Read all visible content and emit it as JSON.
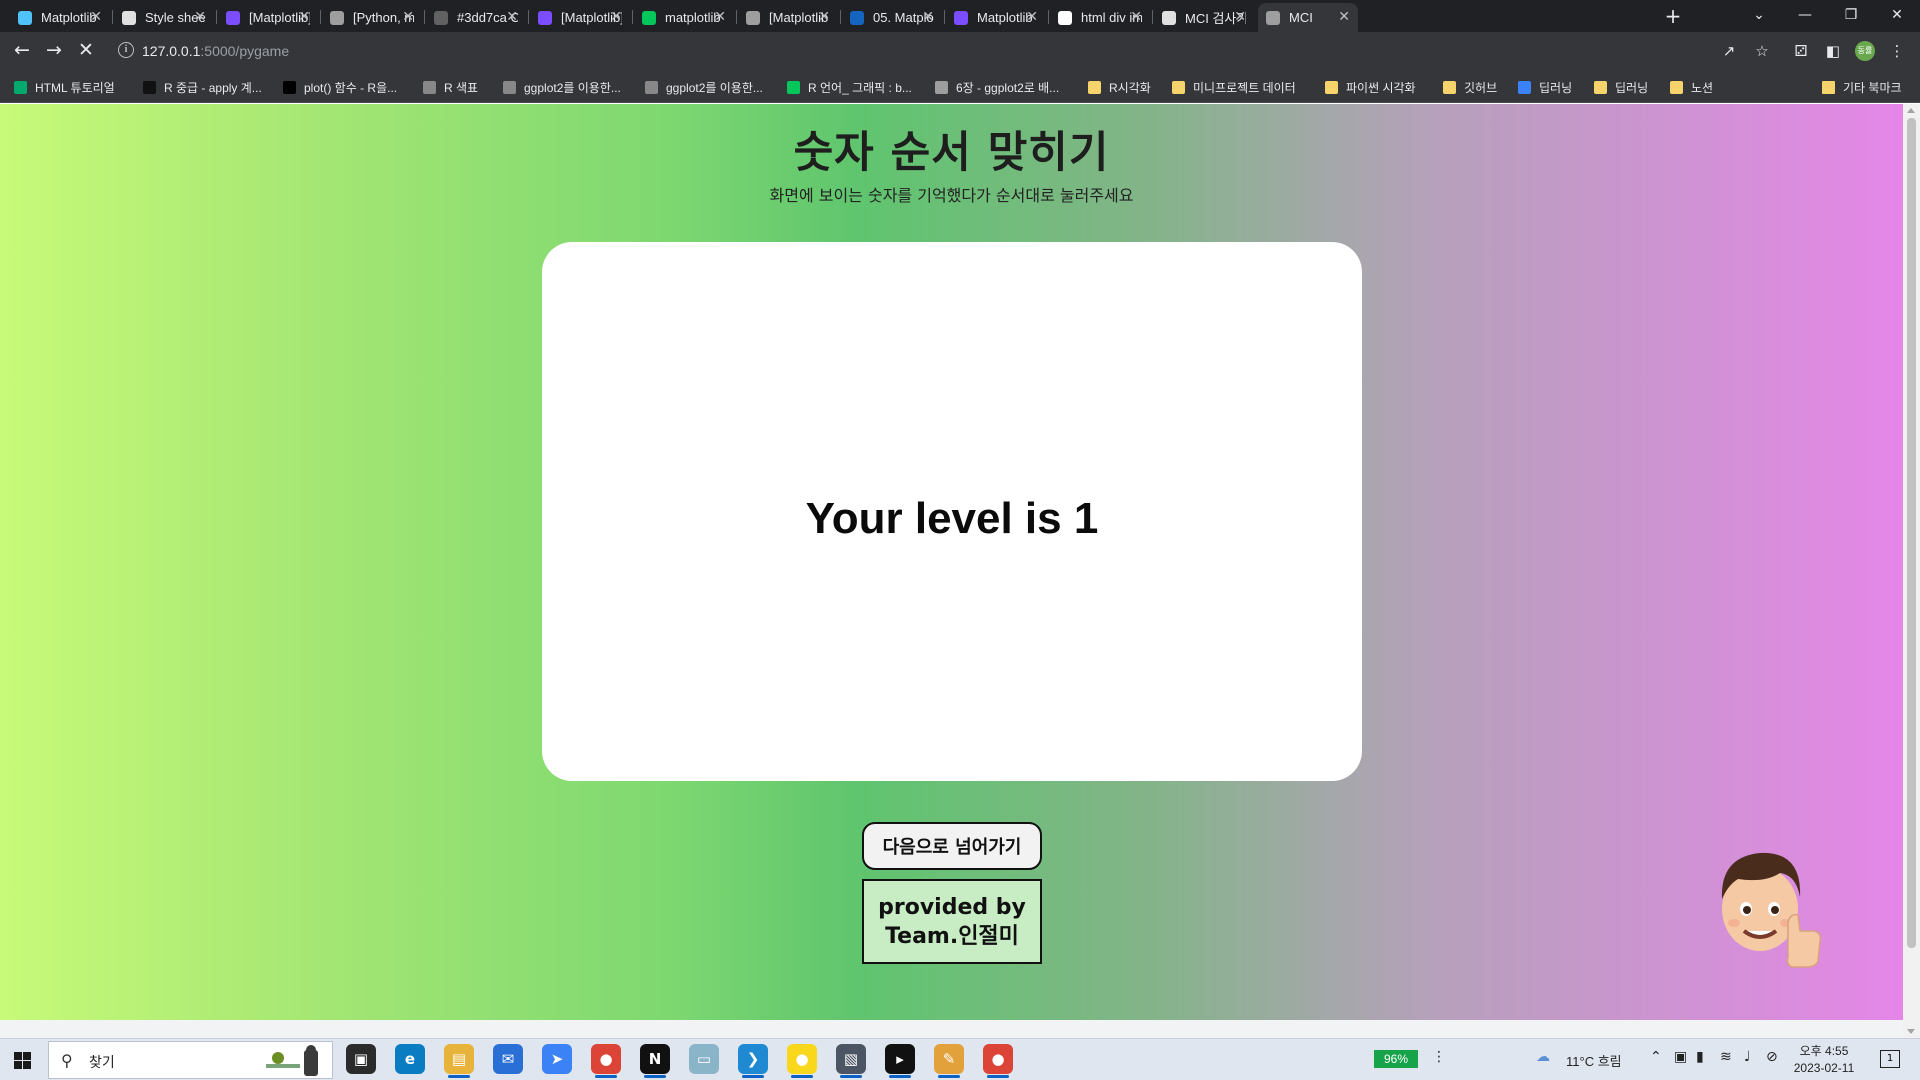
{
  "browser": {
    "tabs": [
      {
        "title": "Matplotlib",
        "color": "#4fc3f7"
      },
      {
        "title": "Style sheet",
        "color": "#e0e0e0"
      },
      {
        "title": "[Matplotlib]",
        "color": "#7c4dff"
      },
      {
        "title": "[Python, ma",
        "color": "#9e9e9e"
      },
      {
        "title": "#3dd7ca C",
        "color": "#616161"
      },
      {
        "title": "[Matplotlib]",
        "color": "#7c4dff"
      },
      {
        "title": "matplotlib",
        "color": "#03c75a"
      },
      {
        "title": "[Matplotlib",
        "color": "#9e9e9e"
      },
      {
        "title": "05. Matplo",
        "color": "#1565c0"
      },
      {
        "title": "Matplotlib",
        "color": "#7c4dff"
      },
      {
        "title": "html div im",
        "color": "#ffffff"
      },
      {
        "title": "MCI 검사기",
        "color": "#e0e0e0"
      },
      {
        "title": "MCI",
        "color": "#9e9e9e"
      }
    ],
    "url_host": "127.0.0.1",
    "url_path": ":5000/pygame",
    "profile_initials": "동률",
    "bookmarks": [
      {
        "label": "HTML 튜토리얼",
        "color": "#04aa6d"
      },
      {
        "label": "R 중급 - apply 계...",
        "color": "#111111"
      },
      {
        "label": "plot() 함수 - R을...",
        "color": "#000000"
      },
      {
        "label": "R 색표",
        "color": "#888888"
      },
      {
        "label": "ggplot2를 이용한...",
        "color": "#888888"
      },
      {
        "label": "ggplot2를 이용한...",
        "color": "#888888"
      },
      {
        "label": "R 언어_ 그래픽 : b...",
        "color": "#03c75a"
      },
      {
        "label": "6장 - ggplot2로 배...",
        "color": "#9e9e9e"
      },
      {
        "label": "R시각화",
        "color": "#f6d36b"
      },
      {
        "label": "미니프로젝트 데이터",
        "color": "#f6d36b"
      },
      {
        "label": "파이썬 시각화",
        "color": "#f6d36b"
      },
      {
        "label": "깃허브",
        "color": "#f6d36b"
      },
      {
        "label": "딥러닝",
        "color": "#3b82f6"
      },
      {
        "label": "딥러닝",
        "color": "#f6d36b"
      },
      {
        "label": "노션",
        "color": "#f6d36b"
      }
    ],
    "other_bookmarks": "기타 북마크"
  },
  "page": {
    "title": "숫자 순서 맞히기",
    "subtitle": "화면에 보이는 숫자를 기억했다가 순서대로 눌러주세요",
    "level_text": "Your level is 1",
    "next_button": "다음으로 넘어가기",
    "credit_line1": "provided by",
    "credit_line2": "Team.인절미"
  },
  "taskbar": {
    "search_placeholder": "찾기",
    "battery": "96%",
    "weather": "11°C  흐림",
    "time": "오후 4:55",
    "date": "2023-02-11",
    "notifications": "1"
  }
}
